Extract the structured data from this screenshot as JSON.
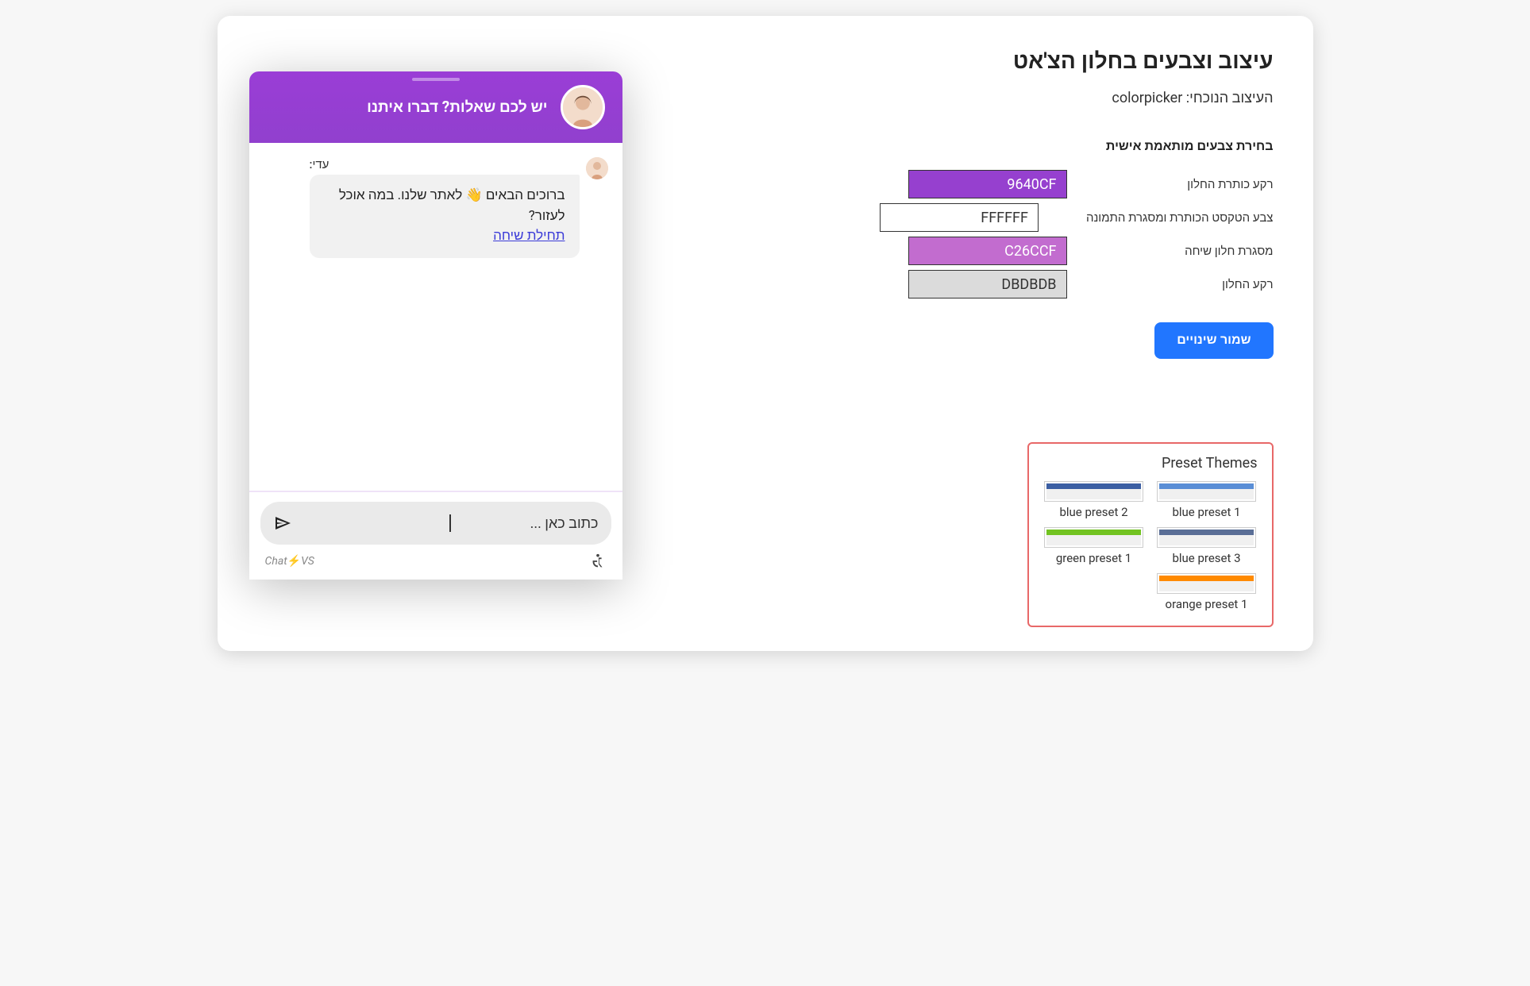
{
  "config": {
    "title": "עיצוב וצבעים בחלון הצ'אט",
    "subtitle_prefix": "העיצוב הנוכחי: ",
    "current_design": "colorpicker",
    "section_label": "בחירת צבעים מותאמת אישית",
    "colors": [
      {
        "label": "רקע כותרת החלון",
        "value": "9640CF",
        "bg": "#9640CF",
        "fg": "#fff"
      },
      {
        "label": "צבע הטקסט הכותרת ומסגרת התמונה",
        "value": "FFFFFF",
        "bg": "#FFFFFF",
        "fg": "#333"
      },
      {
        "label": "מסגרת חלון שיחה",
        "value": "C26CCF",
        "bg": "#C26CCF",
        "fg": "#fff"
      },
      {
        "label": "רקע החלון",
        "value": "DBDBDB",
        "bg": "#DBDBDB",
        "fg": "#333"
      }
    ],
    "save_label": "שמור שינויים"
  },
  "presets": {
    "title": "Preset Themes",
    "items": [
      {
        "label": "blue preset 1",
        "header": "#5a8ed6"
      },
      {
        "label": "blue preset 2",
        "header": "#3c5fa3"
      },
      {
        "label": "blue preset 3",
        "header": "#5a6e96"
      },
      {
        "label": "green preset 1",
        "header": "#72c321"
      },
      {
        "label": "orange preset 1",
        "header": "#ff8a00"
      }
    ]
  },
  "chat": {
    "header_text": "יש לכם שאלות? דברו איתנו",
    "agent_name": "עדי:",
    "msg_text": "ברוכים הבאים 👋 לאתר שלנו. במה אוכל לעזור?",
    "msg_link": "תחילת שיחה",
    "input_placeholder": "כתוב כאן ...",
    "brand_chat": "Chat",
    "brand_vs": "VS"
  }
}
